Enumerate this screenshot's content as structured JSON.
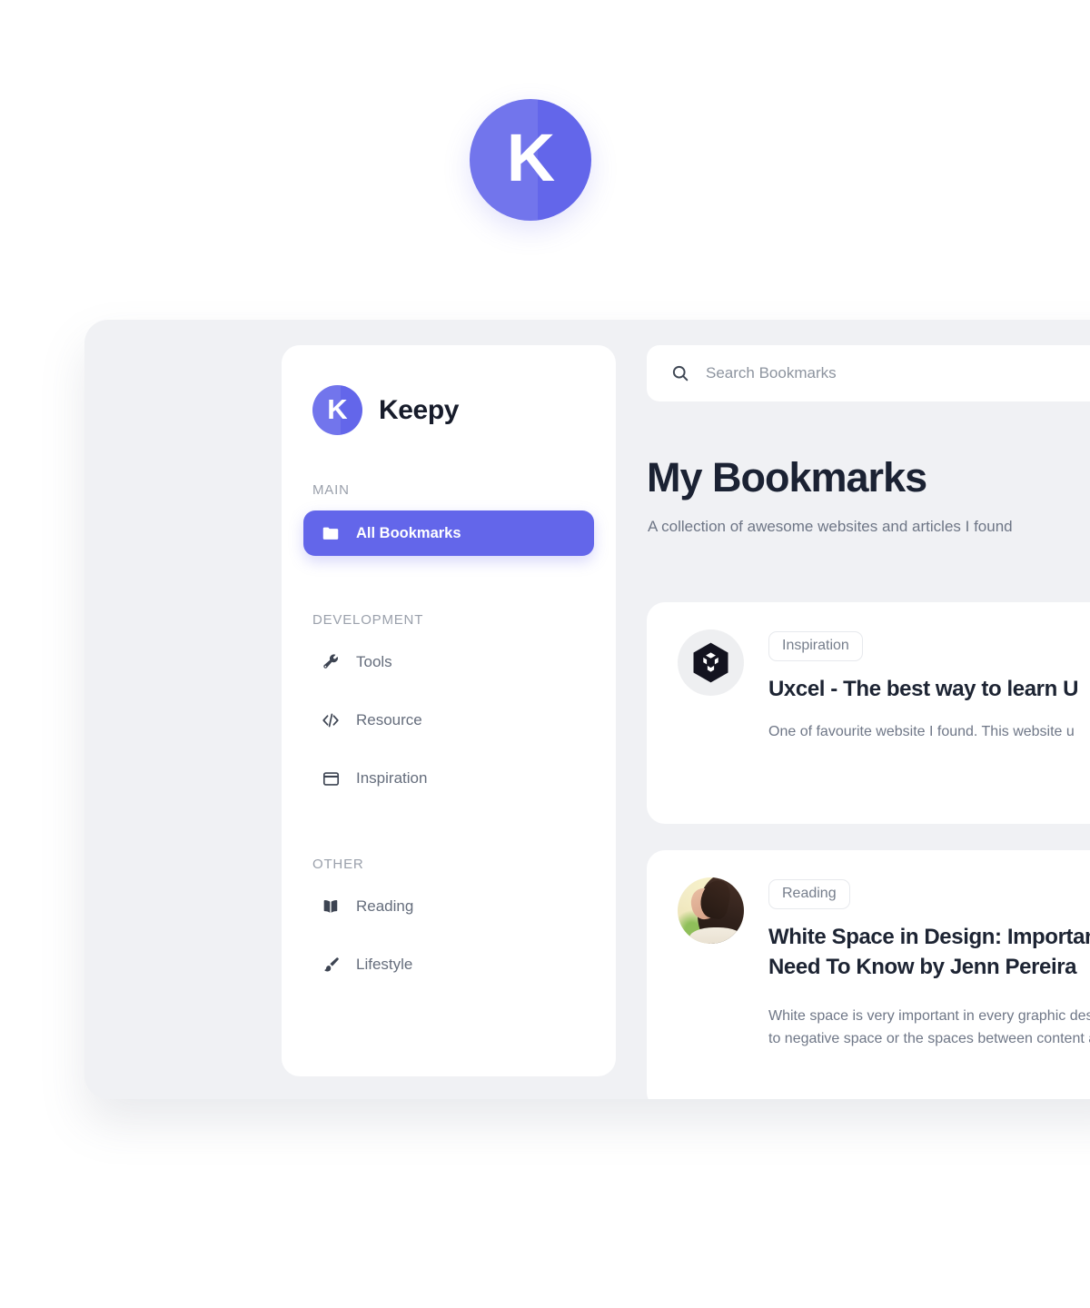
{
  "hero": {
    "logo_letter": "K",
    "brand_color": "#6366ea"
  },
  "sidebar": {
    "brand": {
      "mark_letter": "K",
      "name": "Keepy"
    },
    "groups": [
      {
        "label": "MAIN",
        "items": [
          {
            "label": "All Bookmarks",
            "icon": "folder-icon",
            "active": true
          }
        ]
      },
      {
        "label": "DEVELOPMENT",
        "items": [
          {
            "label": "Tools",
            "icon": "wrench-icon",
            "active": false
          },
          {
            "label": "Resource",
            "icon": "code-brackets-icon",
            "active": false
          },
          {
            "label": "Inspiration",
            "icon": "browser-window-icon",
            "active": false
          }
        ]
      },
      {
        "label": "OTHER",
        "items": [
          {
            "label": "Reading",
            "icon": "open-book-icon",
            "active": false
          },
          {
            "label": "Lifestyle",
            "icon": "paintbrush-icon",
            "active": false
          }
        ]
      }
    ]
  },
  "main": {
    "search": {
      "placeholder": "Search Bookmarks",
      "value": "",
      "icon": "search-icon"
    },
    "title": "My Bookmarks",
    "subtitle": "A collection of awesome websites and articles I found",
    "cards": [
      {
        "thumb_type": "uxcel-hexagon-logo",
        "tag": "Inspiration",
        "title": "Uxcel - The best way to learn U",
        "description": "One of favourite website I found. This website u"
      },
      {
        "thumb_type": "author-avatar-photo",
        "tag": "Reading",
        "title": "White Space in Design: Importance, Things You Need To Know by Jenn Pereira",
        "description": "White space is very important in every graphic design. Designers use to refer to negative space or the spaces between content and elements"
      }
    ]
  }
}
